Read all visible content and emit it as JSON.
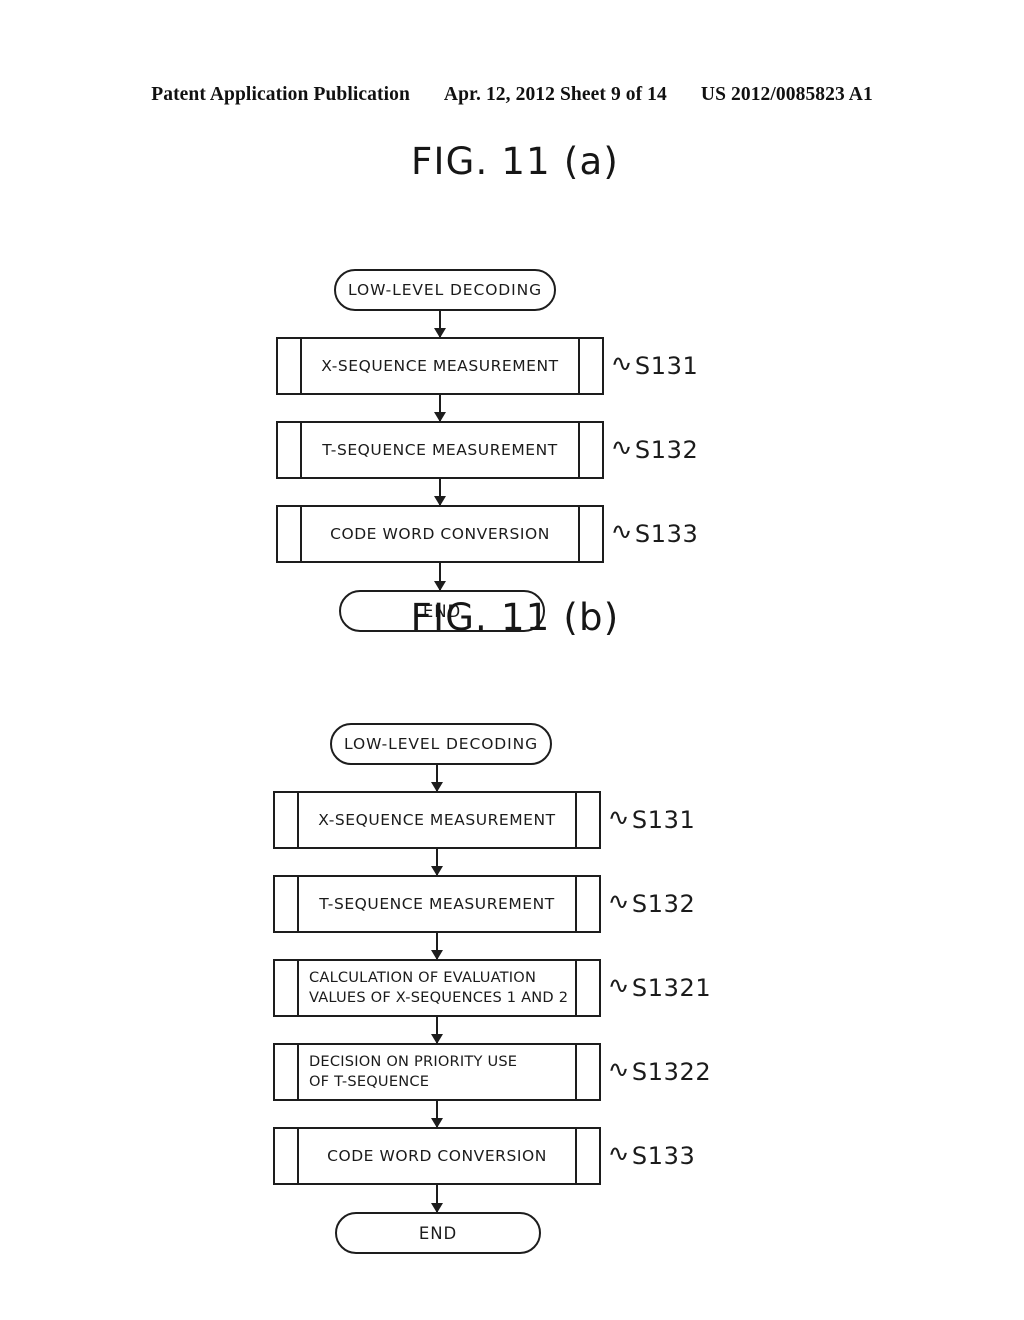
{
  "header": {
    "publication": "Patent Application Publication",
    "date_sheet": "Apr. 12, 2012  Sheet 9 of 14",
    "publication_number": "US 2012/0085823 A1"
  },
  "figures": [
    {
      "id": "figure-a",
      "title": "FIG. 11 (a)",
      "start_label": "LOW-LEVEL DECODING",
      "end_label": "END",
      "steps": [
        {
          "text_line1": "X-SEQUENCE MEASUREMENT",
          "text_line2": "",
          "tilde": "∿",
          "ref": "S131"
        },
        {
          "text_line1": "T-SEQUENCE MEASUREMENT",
          "text_line2": "",
          "tilde": "∿",
          "ref": "S132"
        },
        {
          "text_line1": "CODE WORD CONVERSION",
          "text_line2": "",
          "tilde": "∿",
          "ref": "S133"
        }
      ]
    },
    {
      "id": "figure-b",
      "title": "FIG. 11 (b)",
      "start_label": "LOW-LEVEL DECODING",
      "end_label": "END",
      "steps": [
        {
          "text_line1": "X-SEQUENCE MEASUREMENT",
          "text_line2": "",
          "tilde": "∿",
          "ref": "S131"
        },
        {
          "text_line1": "T-SEQUENCE MEASUREMENT",
          "text_line2": "",
          "tilde": "∿",
          "ref": "S132"
        },
        {
          "text_line1": "CALCULATION OF EVALUATION",
          "text_line2": "VALUES OF X-SEQUENCES 1 AND 2",
          "tilde": "∿",
          "ref": "S1321"
        },
        {
          "text_line1": "DECISION ON PRIORITY USE",
          "text_line2": "OF T-SEQUENCE",
          "tilde": "∿",
          "ref": "S1322"
        },
        {
          "text_line1": "CODE WORD CONVERSION",
          "text_line2": "",
          "tilde": "∿",
          "ref": "S133"
        }
      ]
    }
  ],
  "colors": {
    "ink": "#1d1d1d",
    "paper": "#ffffff"
  }
}
